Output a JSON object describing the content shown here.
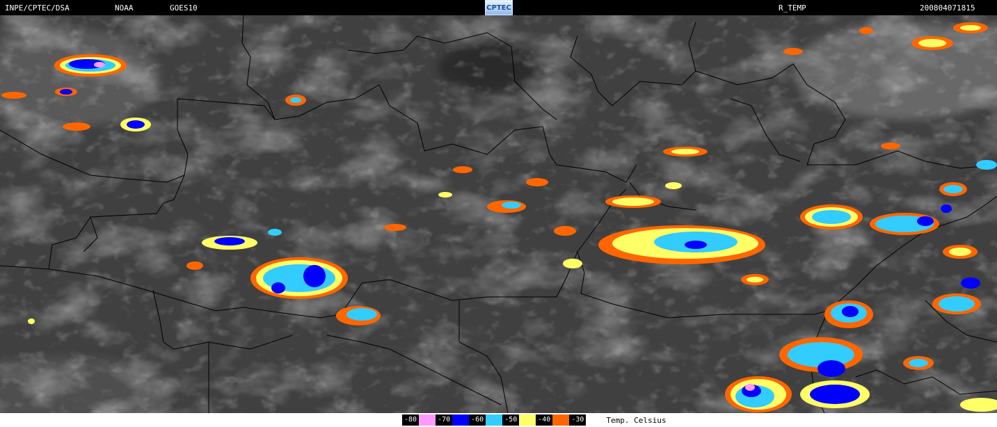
{
  "header": {
    "source": "INPE/CPTEC/DSA",
    "agency": "NOAA",
    "satellite": "GOES10",
    "logo_text": "CPTEC",
    "product": "R_TEMP",
    "timestamp": "200804071815"
  },
  "legend": {
    "title": "Temp. Celsius",
    "items": [
      {
        "label": "-80",
        "color": "#ff99ff"
      },
      {
        "label": "-70",
        "color": "#0000ff"
      },
      {
        "label": "-60",
        "color": "#33ccff"
      },
      {
        "label": "-50",
        "color": "#ffff66"
      },
      {
        "label": "-40",
        "color": "#ff6600"
      },
      {
        "label": "-30",
        "color": "#ffffff"
      }
    ]
  },
  "map": {
    "background_color": "#404040",
    "border_color": "#000000"
  }
}
